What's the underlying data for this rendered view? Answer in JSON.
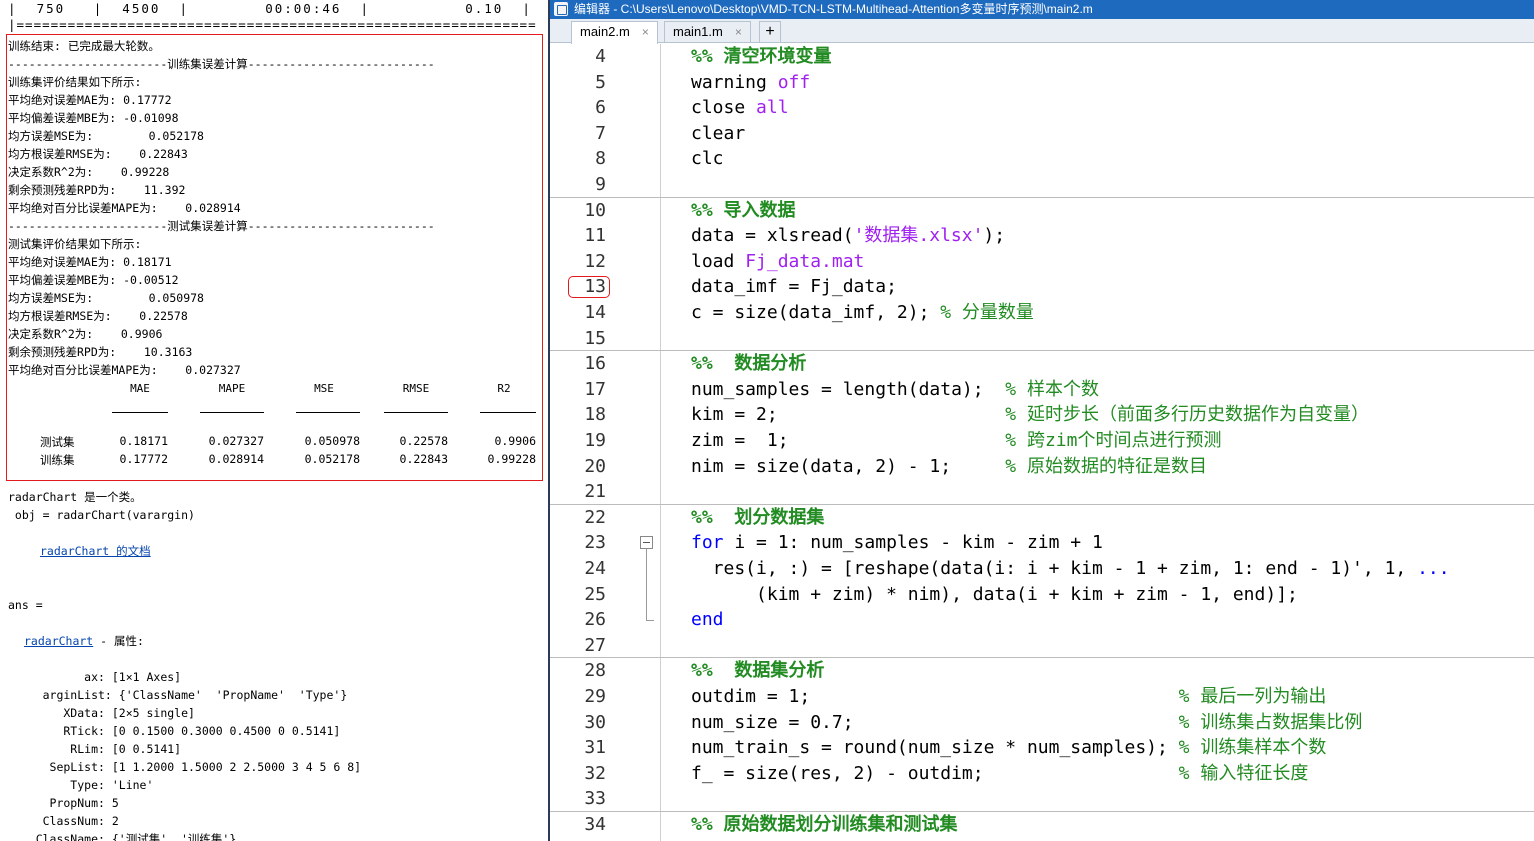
{
  "cmd": {
    "header": "|  750   |  4500  |        00:00:46  |          0.10  |",
    "divider": "|=============================================================",
    "lines": [
      "训练结束: 已完成最大轮数。",
      "-----------------------训练集误差计算---------------------------",
      "训练集评价结果如下所示:",
      "平均绝对误差MAE为: 0.17772",
      "平均偏差误差MBE为: -0.01098",
      "均方误差MSE为:        0.052178",
      "均方根误差RMSE为:    0.22843",
      "决定系数R^2为:    0.99228",
      "剩余预测残差RPD为:    11.392",
      "平均绝对百分比误差MAPE为:    0.028914",
      "-----------------------测试集误差计算---------------------------",
      "测试集评价结果如下所示:",
      "平均绝对误差MAE为: 0.18171",
      "平均偏差误差MBE为: -0.00512",
      "均方误差MSE为:        0.050978",
      "均方根误差RMSE为:    0.22578",
      "决定系数R^2为:    0.9906",
      "剩余预测残差RPD为:    10.3163",
      "平均绝对百分比误差MAPE为:    0.027327"
    ],
    "table": {
      "headers": [
        "MAE",
        "MAPE",
        "MSE",
        "RMSE",
        "R2"
      ],
      "rows": [
        {
          "label": "测试集",
          "values": [
            "0.18171",
            "0.027327",
            "0.050978",
            "0.22578",
            "0.9906"
          ]
        },
        {
          "label": "训练集",
          "values": [
            "0.17772",
            "0.028914",
            "0.052178",
            "0.22843",
            "0.99228"
          ]
        }
      ]
    },
    "radar_line1": "radarChart 是一个类。",
    "radar_line2": " obj = radarChart(varargin)",
    "radar_doc_link": "radarChart 的文档",
    "ans_line": "ans =",
    "props_link": "radarChart",
    "props_suffix": " - 属性:",
    "props": [
      "           ax: [1×1 Axes]",
      "     arginList: {'ClassName'  'PropName'  'Type'}",
      "        XData: [2×5 single]",
      "        RTick: [0 0.1500 0.3000 0.4500 0 0.5141]",
      "         RLim: [0 0.5141]",
      "      SepList: [1 1.2000 1.5000 2 2.5000 3 4 5 6 8]",
      "         Type: 'Line'",
      "      PropNum: 5",
      "     ClassNum: 2",
      "    ClassName: {'测试集'  '训练集'}"
    ]
  },
  "editor": {
    "title": "编辑器 - C:\\Users\\Lenovo\\Desktop\\VMD-TCN-LSTM-Multihead-Attention多变量时序预测\\main2.m",
    "tabs": [
      {
        "label": "main2.m",
        "close": "×"
      },
      {
        "label": "main1.m",
        "close": "×"
      }
    ],
    "add_tab": "+",
    "lines": [
      {
        "n": "4",
        "parts": [
          [
            "cell",
            "%% 清空环境变量"
          ]
        ]
      },
      {
        "n": "5",
        "parts": [
          [
            "",
            "warning "
          ],
          [
            "str",
            "off"
          ]
        ]
      },
      {
        "n": "6",
        "parts": [
          [
            "",
            "close "
          ],
          [
            "str",
            "all"
          ]
        ]
      },
      {
        "n": "7",
        "parts": [
          [
            "",
            "clear"
          ]
        ]
      },
      {
        "n": "8",
        "parts": [
          [
            "",
            "clc"
          ]
        ]
      },
      {
        "n": "9",
        "parts": []
      },
      {
        "n": "10",
        "parts": [
          [
            "cell",
            "%% 导入数据"
          ]
        ]
      },
      {
        "n": "11",
        "parts": [
          [
            "",
            "data = xlsread("
          ],
          [
            "str",
            "'数据集.xlsx'"
          ],
          [
            "",
            ");"
          ]
        ]
      },
      {
        "n": "12",
        "parts": [
          [
            "",
            "load "
          ],
          [
            "str",
            "Fj_data.mat"
          ]
        ]
      },
      {
        "n": "13",
        "parts": [
          [
            "",
            "data_imf = Fj_data;"
          ]
        ]
      },
      {
        "n": "14",
        "parts": [
          [
            "",
            "c = size(data_imf, 2); "
          ],
          [
            "cm",
            "% 分量数量"
          ]
        ]
      },
      {
        "n": "15",
        "parts": []
      },
      {
        "n": "16",
        "parts": [
          [
            "cell",
            "%%  数据分析"
          ]
        ]
      },
      {
        "n": "17",
        "parts": [
          [
            "",
            "num_samples = length(data);  "
          ],
          [
            "cm",
            "% 样本个数"
          ]
        ]
      },
      {
        "n": "18",
        "parts": [
          [
            "",
            "kim = 2;                     "
          ],
          [
            "cm",
            "% 延时步长（前面多行历史数据作为自变量）"
          ]
        ]
      },
      {
        "n": "19",
        "parts": [
          [
            "",
            "zim =  1;                    "
          ],
          [
            "cm",
            "% 跨zim个时间点进行预测"
          ]
        ]
      },
      {
        "n": "20",
        "parts": [
          [
            "",
            "nim = size(data, 2) - 1;     "
          ],
          [
            "cm",
            "% 原始数据的特征是数目"
          ]
        ]
      },
      {
        "n": "21",
        "parts": []
      },
      {
        "n": "22",
        "parts": [
          [
            "cell",
            "%%  划分数据集"
          ]
        ]
      },
      {
        "n": "23",
        "parts": [
          [
            "kw",
            "for"
          ],
          [
            "",
            " i = 1: num_samples - kim - zim + 1"
          ]
        ]
      },
      {
        "n": "24",
        "parts": [
          [
            "",
            "  res(i, :) = [reshape(data(i: i + kim - 1 + zim, 1: end - 1)', 1, "
          ],
          [
            "kw",
            "..."
          ]
        ]
      },
      {
        "n": "25",
        "parts": [
          [
            "",
            "      (kim + zim) * nim), data(i + kim + zim - 1, end)];"
          ]
        ]
      },
      {
        "n": "26",
        "parts": [
          [
            "kw",
            "end"
          ]
        ]
      },
      {
        "n": "27",
        "parts": []
      },
      {
        "n": "28",
        "parts": [
          [
            "cell",
            "%%  数据集分析"
          ]
        ]
      },
      {
        "n": "29",
        "parts": [
          [
            "",
            "outdim = 1;                                  "
          ],
          [
            "cm",
            "% 最后一列为输出"
          ]
        ]
      },
      {
        "n": "30",
        "parts": [
          [
            "",
            "num_size = 0.7;                              "
          ],
          [
            "cm",
            "% 训练集占数据集比例"
          ]
        ]
      },
      {
        "n": "31",
        "parts": [
          [
            "",
            "num_train_s = round(num_size * num_samples); "
          ],
          [
            "cm",
            "% 训练集样本个数"
          ]
        ]
      },
      {
        "n": "32",
        "parts": [
          [
            "",
            "f_ = size(res, 2) - outdim;                  "
          ],
          [
            "cm",
            "% 输入特征长度"
          ]
        ]
      },
      {
        "n": "33",
        "parts": []
      },
      {
        "n": "34",
        "parts": [
          [
            "cell",
            "%% 原始数据划分训练集和测试集"
          ]
        ]
      }
    ]
  }
}
